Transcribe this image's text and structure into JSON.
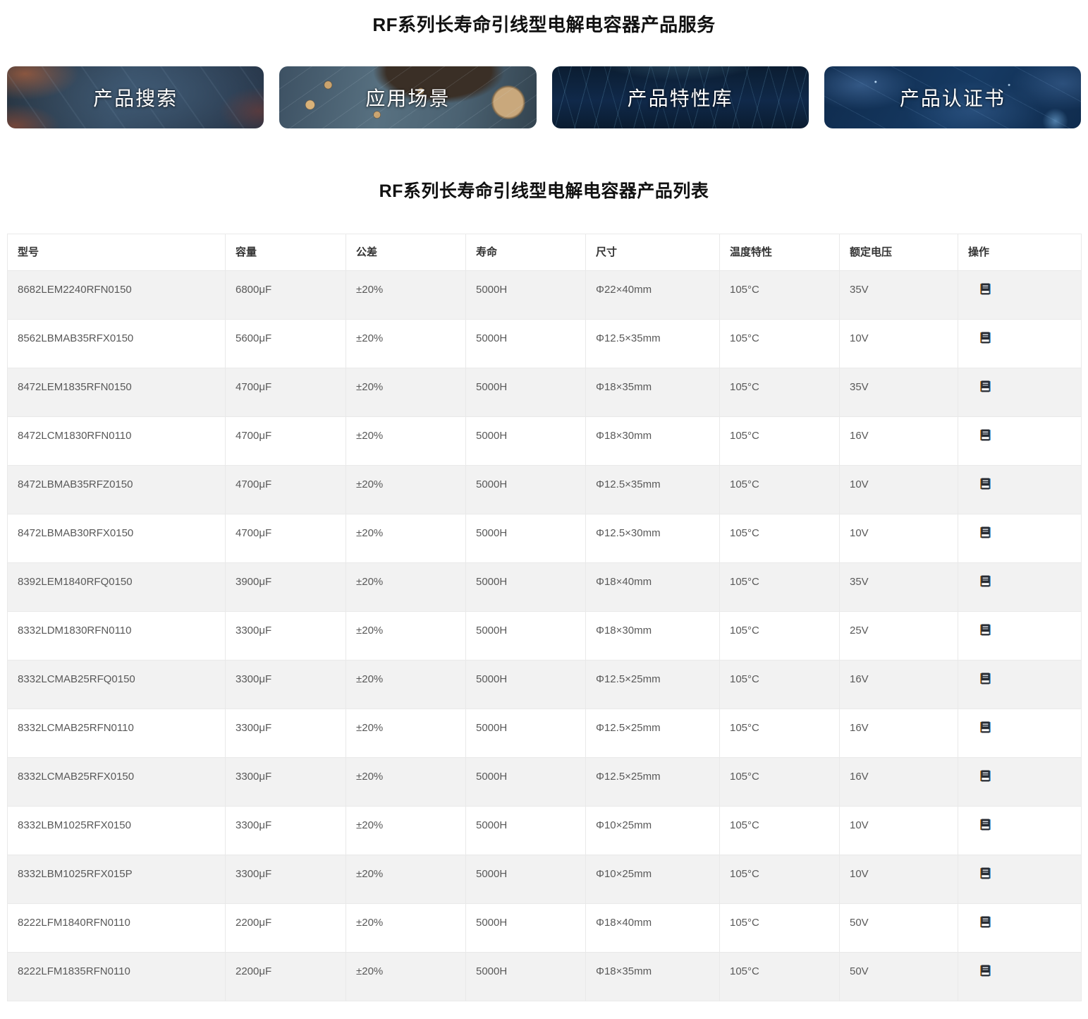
{
  "page": {
    "service_title": "RF系列长寿命引线型电解电容器产品服务",
    "list_title": "RF系列长寿命引线型电解电容器产品列表"
  },
  "banners": [
    {
      "label": "产品搜索",
      "image": "dark-circuit-orange-bokeh"
    },
    {
      "label": "应用场景",
      "image": "pcb-board-photo"
    },
    {
      "label": "产品特性库",
      "image": "navy-light-streaks"
    },
    {
      "label": "产品认证书",
      "image": "navy-world-map"
    }
  ],
  "table": {
    "columns": [
      "型号",
      "容量",
      "公差",
      "寿命",
      "尺寸",
      "温度特性",
      "额定电压",
      "操作"
    ],
    "action_icon": "notebook-icon",
    "rows": [
      {
        "model": "8682LEM2240RFN0150",
        "capacity": "6800μF",
        "tolerance": "±20%",
        "life": "5000H",
        "size": "Φ22×40mm",
        "temp": "105°C",
        "voltage": "35V"
      },
      {
        "model": "8562LBMAB35RFX0150",
        "capacity": "5600μF",
        "tolerance": "±20%",
        "life": "5000H",
        "size": "Φ12.5×35mm",
        "temp": "105°C",
        "voltage": "10V"
      },
      {
        "model": "8472LEM1835RFN0150",
        "capacity": "4700μF",
        "tolerance": "±20%",
        "life": "5000H",
        "size": "Φ18×35mm",
        "temp": "105°C",
        "voltage": "35V"
      },
      {
        "model": "8472LCM1830RFN0110",
        "capacity": "4700μF",
        "tolerance": "±20%",
        "life": "5000H",
        "size": "Φ18×30mm",
        "temp": "105°C",
        "voltage": "16V"
      },
      {
        "model": "8472LBMAB35RFZ0150",
        "capacity": "4700μF",
        "tolerance": "±20%",
        "life": "5000H",
        "size": "Φ12.5×35mm",
        "temp": "105°C",
        "voltage": "10V"
      },
      {
        "model": "8472LBMAB30RFX0150",
        "capacity": "4700μF",
        "tolerance": "±20%",
        "life": "5000H",
        "size": "Φ12.5×30mm",
        "temp": "105°C",
        "voltage": "10V"
      },
      {
        "model": "8392LEM1840RFQ0150",
        "capacity": "3900μF",
        "tolerance": "±20%",
        "life": "5000H",
        "size": "Φ18×40mm",
        "temp": "105°C",
        "voltage": "35V"
      },
      {
        "model": "8332LDM1830RFN0110",
        "capacity": "3300μF",
        "tolerance": "±20%",
        "life": "5000H",
        "size": "Φ18×30mm",
        "temp": "105°C",
        "voltage": "25V"
      },
      {
        "model": "8332LCMAB25RFQ0150",
        "capacity": "3300μF",
        "tolerance": "±20%",
        "life": "5000H",
        "size": "Φ12.5×25mm",
        "temp": "105°C",
        "voltage": "16V"
      },
      {
        "model": "8332LCMAB25RFN0110",
        "capacity": "3300μF",
        "tolerance": "±20%",
        "life": "5000H",
        "size": "Φ12.5×25mm",
        "temp": "105°C",
        "voltage": "16V"
      },
      {
        "model": "8332LCMAB25RFX0150",
        "capacity": "3300μF",
        "tolerance": "±20%",
        "life": "5000H",
        "size": "Φ12.5×25mm",
        "temp": "105°C",
        "voltage": "16V"
      },
      {
        "model": "8332LBM1025RFX0150",
        "capacity": "3300μF",
        "tolerance": "±20%",
        "life": "5000H",
        "size": "Φ10×25mm",
        "temp": "105°C",
        "voltage": "10V"
      },
      {
        "model": "8332LBM1025RFX015P",
        "capacity": "3300μF",
        "tolerance": "±20%",
        "life": "5000H",
        "size": "Φ10×25mm",
        "temp": "105°C",
        "voltage": "10V"
      },
      {
        "model": "8222LFM1840RFN0110",
        "capacity": "2200μF",
        "tolerance": "±20%",
        "life": "5000H",
        "size": "Φ18×40mm",
        "temp": "105°C",
        "voltage": "50V"
      },
      {
        "model": "8222LFM1835RFN0110",
        "capacity": "2200μF",
        "tolerance": "±20%",
        "life": "5000H",
        "size": "Φ18×35mm",
        "temp": "105°C",
        "voltage": "50V"
      }
    ]
  },
  "colors": {
    "stripe_row": "#f2f2f2",
    "table_border": "#e9e9e9",
    "header_text": "#333333",
    "cell_text": "#595959",
    "banner_navy": "#0f2b4d",
    "icon_orange_edge": "#e8912d",
    "icon_blue_edge": "#4aa3e0"
  }
}
